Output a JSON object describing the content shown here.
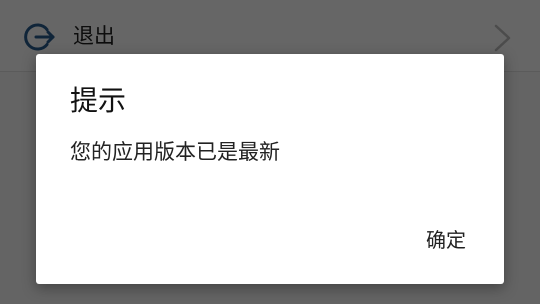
{
  "list": {
    "logout_row": {
      "label": "退出",
      "icon": "logout-icon",
      "trailing_icon": "chevron-right-icon"
    }
  },
  "dialog": {
    "title": "提示",
    "message": "您的应用版本已是最新",
    "confirm_label": "确定"
  },
  "colors": {
    "icon_accent": "#2a5d8f",
    "scrim": "#000000",
    "dialog_background": "#ffffff"
  }
}
